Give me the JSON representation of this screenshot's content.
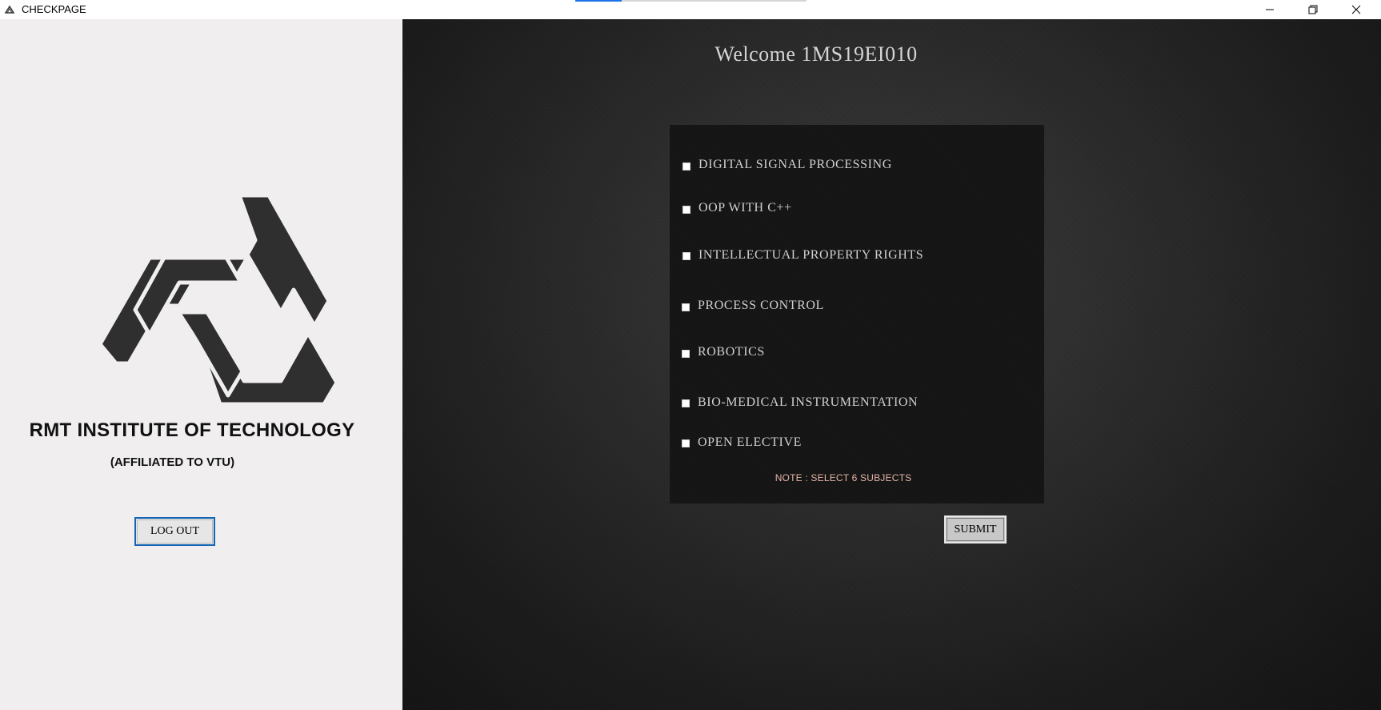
{
  "window": {
    "title": "CHECKPAGE",
    "controls": {
      "minimize_icon": "minimize-icon",
      "restore_icon": "restore-icon",
      "close_icon": "close-icon"
    }
  },
  "left_panel": {
    "logo_icon": "institute-logo",
    "institute_name": "RMT INSTITUTE OF TECHNOLOGY",
    "affiliation": "(AFFILIATED TO VTU)",
    "logout_label": "LOG OUT"
  },
  "main": {
    "welcome": "Welcome 1MS19EI010",
    "subjects": [
      {
        "label": "DIGITAL SIGNAL PROCESSING",
        "checked": false
      },
      {
        "label": "OOP WITH C++",
        "checked": false
      },
      {
        "label": "INTELLECTUAL PROPERTY RIGHTS",
        "checked": false
      },
      {
        "label": "PROCESS CONTROL",
        "checked": false
      },
      {
        "label": "ROBOTICS",
        "checked": false
      },
      {
        "label": "BIO-MEDICAL INSTRUMENTATION",
        "checked": false
      },
      {
        "label": "OPEN ELECTIVE",
        "checked": false
      }
    ],
    "note": "NOTE : SELECT 6 SUBJECTS",
    "submit_label": "SUBMIT"
  },
  "colors": {
    "accent_border": "#1565b5",
    "note_text": "#e3b4a6",
    "dark_background": "#1e1e1e",
    "light_background": "#f0eeef"
  }
}
